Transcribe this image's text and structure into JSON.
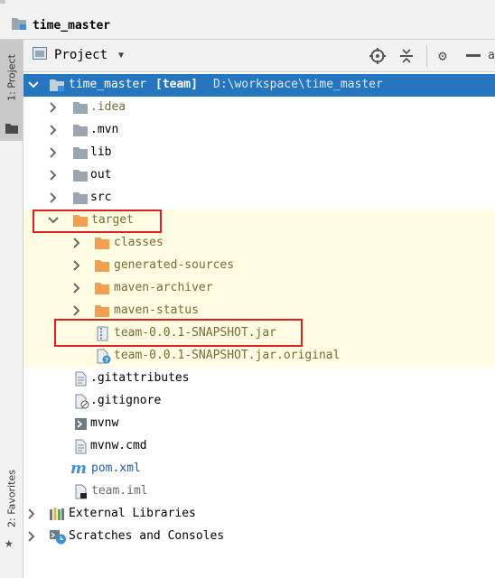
{
  "breadcrumb": {
    "project_name": "time_master"
  },
  "side_strip": {
    "project_tab": "1: Project",
    "favorites_tab": "2: Favorites"
  },
  "panel_header": {
    "view_label": "Project",
    "cut_text": "a",
    "icons": [
      "locate-icon",
      "collapse-all-icon",
      "gear-icon",
      "hide-icon"
    ]
  },
  "tree": {
    "root": {
      "name": "time_master",
      "module": "[team]",
      "path": "D:\\workspace\\time_master"
    },
    "nodes": [
      {
        "label": ".idea",
        "icon": "folder-icon"
      },
      {
        "label": ".mvn",
        "icon": "folder-icon"
      },
      {
        "label": "lib",
        "icon": "folder-icon"
      },
      {
        "label": "out",
        "icon": "folder-icon"
      },
      {
        "label": "src",
        "icon": "folder-icon"
      },
      {
        "label": "target",
        "icon": "folder-excluded-icon"
      },
      {
        "label": "classes",
        "icon": "folder-excluded-icon"
      },
      {
        "label": "generated-sources",
        "icon": "folder-excluded-icon"
      },
      {
        "label": "maven-archiver",
        "icon": "folder-excluded-icon"
      },
      {
        "label": "maven-status",
        "icon": "folder-excluded-icon"
      },
      {
        "label": "team-0.0.1-SNAPSHOT.jar",
        "icon": "jar-archive-icon"
      },
      {
        "label": "team-0.0.1-SNAPSHOT.jar.original",
        "icon": "unknown-file-icon"
      },
      {
        "label": ".gitattributes",
        "icon": "text-file-icon"
      },
      {
        "label": ".gitignore",
        "icon": "ignored-file-icon"
      },
      {
        "label": "mvnw",
        "icon": "shell-script-icon"
      },
      {
        "label": "mvnw.cmd",
        "icon": "text-file-icon"
      },
      {
        "label": "pom.xml",
        "icon": "maven-icon"
      },
      {
        "label": "team.iml",
        "icon": "module-file-icon"
      },
      {
        "label": "External Libraries",
        "icon": "libraries-icon"
      },
      {
        "label": "Scratches and Consoles",
        "icon": "scratches-icon"
      }
    ]
  },
  "colors": {
    "selection": "#2675bf",
    "excluded_highlight": "#fefde4",
    "excluded_folder": "#f0a050",
    "folder": "#9aa7b0",
    "annotation_box": "#e02020"
  }
}
